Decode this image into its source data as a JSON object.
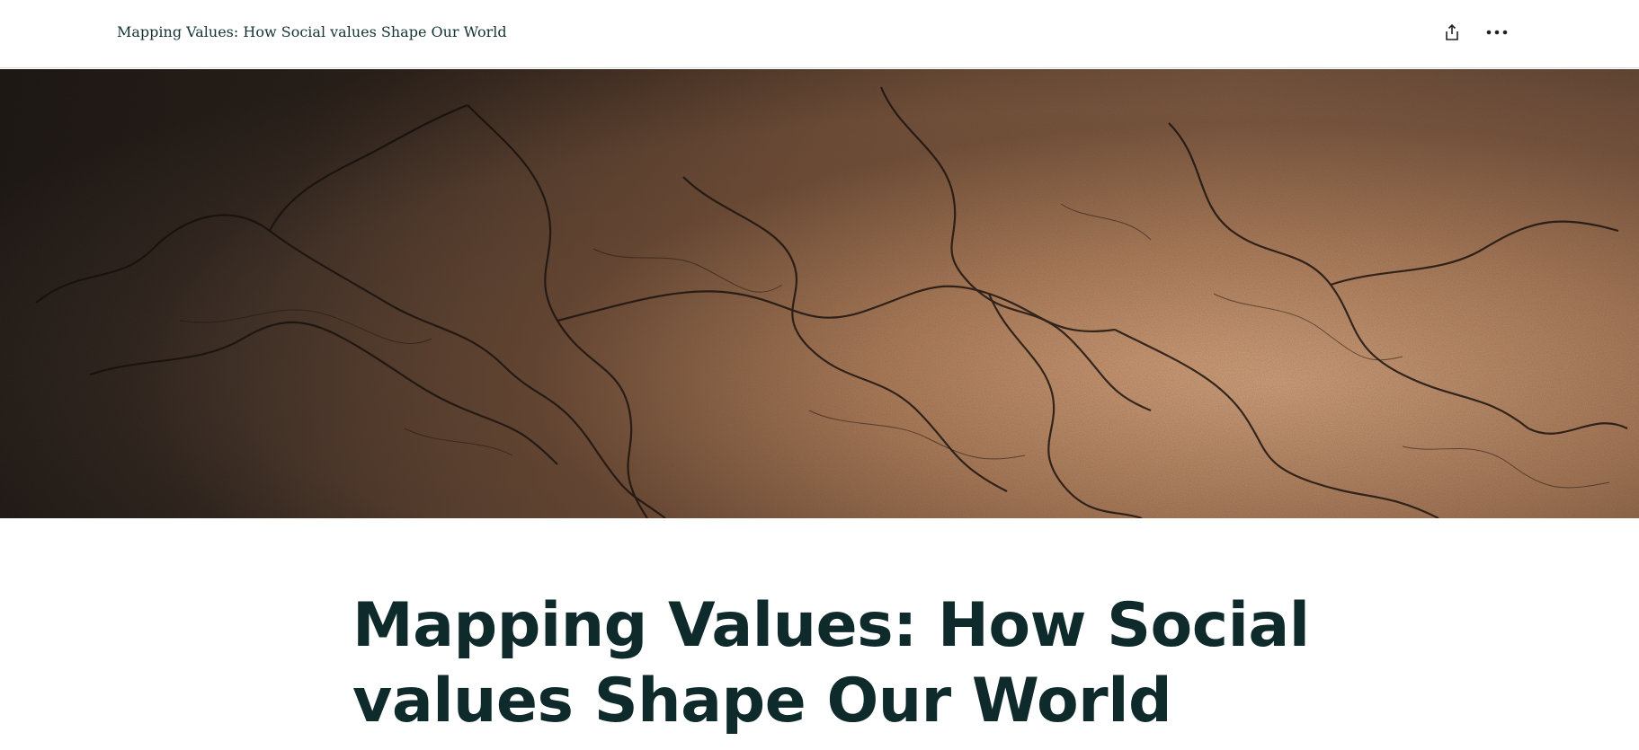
{
  "header": {
    "story_title": "Mapping Values: How Social values Shape Our World",
    "share_icon": "share-icon",
    "more_icon": "more-options-icon"
  },
  "hero": {
    "image_description_icon": "antique-map-image"
  },
  "article": {
    "headline": "Mapping Values: How Social values Shape Our World"
  },
  "colors": {
    "headline": "#0f2a2a",
    "header_text": "#163333",
    "hero_light": "#dcaa82",
    "hero_dark": "#2e241f"
  }
}
